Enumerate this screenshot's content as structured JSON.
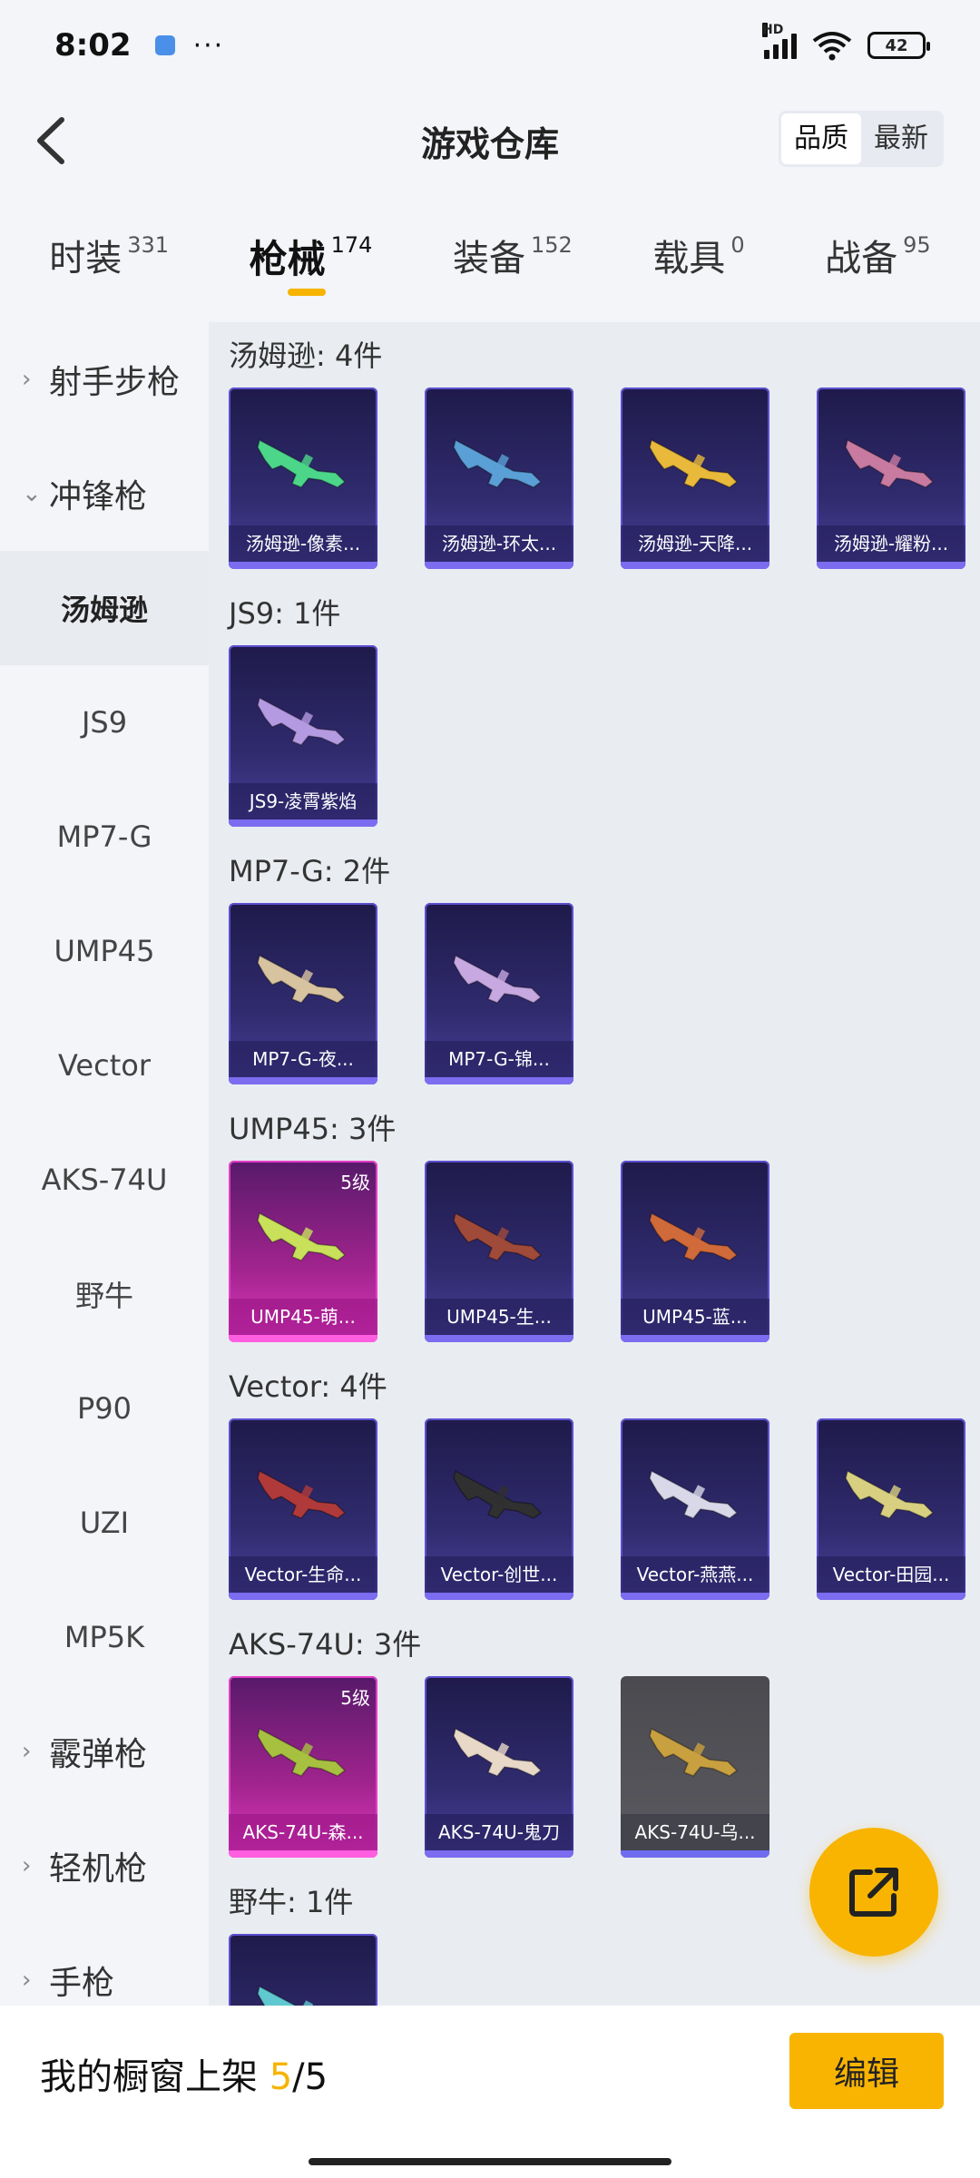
{
  "status": {
    "time": "8:02",
    "dots": "···",
    "hd": "HD",
    "battery": "42"
  },
  "header": {
    "title": "游戏仓库",
    "sort_quality": "品质",
    "sort_latest": "最新"
  },
  "tabs": [
    {
      "label": "时装",
      "count": "331"
    },
    {
      "label": "枪械",
      "count": "174"
    },
    {
      "label": "装备",
      "count": "152"
    },
    {
      "label": "载具",
      "count": "0"
    },
    {
      "label": "战备",
      "count": "95"
    }
  ],
  "sidebar": {
    "groups": [
      {
        "label": "射手步枪"
      },
      {
        "label": "冲锋枪"
      },
      {
        "label": "霰弹枪"
      },
      {
        "label": "轻机枪"
      },
      {
        "label": "手枪"
      }
    ],
    "subs": [
      "汤姆逊",
      "JS9",
      "MP7-G",
      "UMP45",
      "Vector",
      "AKS-74U",
      "野牛",
      "P90",
      "UZI",
      "MP5K"
    ]
  },
  "sections": [
    {
      "title": "汤姆逊: 4件",
      "items": [
        {
          "label": "汤姆逊-像素...",
          "color": "#4cd68a"
        },
        {
          "label": "汤姆逊-环太...",
          "color": "#5a9fd6"
        },
        {
          "label": "汤姆逊-天降...",
          "color": "#e8b93a"
        },
        {
          "label": "汤姆逊-耀粉...",
          "color": "#c87aa0"
        }
      ]
    },
    {
      "title": "JS9: 1件",
      "items": [
        {
          "label": "JS9-凌霄紫焰",
          "color": "#b49ae0"
        }
      ]
    },
    {
      "title": "MP7-G: 2件",
      "items": [
        {
          "label": "MP7-G-夜...",
          "color": "#d8c3a0"
        },
        {
          "label": "MP7-G-锦...",
          "color": "#c7a8e0"
        }
      ]
    },
    {
      "title": "UMP45: 3件",
      "items": [
        {
          "label": "UMP45-萌...",
          "color": "#c8e05a",
          "badge": "5级"
        },
        {
          "label": "UMP45-生...",
          "color": "#a04a3a"
        },
        {
          "label": "UMP45-蓝...",
          "color": "#d06a3a"
        }
      ]
    },
    {
      "title": "Vector: 4件",
      "items": [
        {
          "label": "Vector-生命...",
          "color": "#b03a3a"
        },
        {
          "label": "Vector-创世...",
          "color": "#303030"
        },
        {
          "label": "Vector-燕燕...",
          "color": "#d8d8e8"
        },
        {
          "label": "Vector-田园...",
          "color": "#d8d080"
        }
      ]
    },
    {
      "title": "AKS-74U: 3件",
      "items": [
        {
          "label": "AKS-74U-森...",
          "color": "#a8c040",
          "badge": "5级"
        },
        {
          "label": "AKS-74U-鬼刀",
          "color": "#e8d8c8"
        },
        {
          "label": "AKS-74U-乌...",
          "color": "#c8a040"
        }
      ]
    },
    {
      "title": "野牛: 1件",
      "items": [
        {
          "label": "",
          "color": "#60c8d0"
        }
      ]
    }
  ],
  "bottom": {
    "showcase_label": "我的橱窗上架",
    "current": "5",
    "sep_total": "/5",
    "edit": "编辑"
  },
  "colors": {
    "accent": "#f8b400",
    "card_purple": "#302b6e",
    "card_pink": "#a2248e"
  }
}
